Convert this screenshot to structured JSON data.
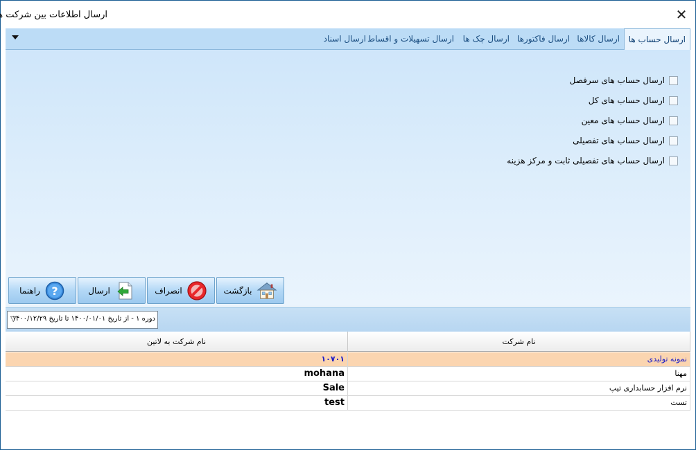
{
  "window": {
    "title": "ارسال اطلاعات بین شرکت ها",
    "close_glyph": "✕"
  },
  "tabs": [
    {
      "label": "ارسال حساب ها",
      "active": true
    },
    {
      "label": "ارسال کالاها",
      "active": false
    },
    {
      "label": "ارسال فاکتورها",
      "active": false
    },
    {
      "label": "ارسال چک ها",
      "active": false
    },
    {
      "label": "ارسال تسهیلات و اقساط",
      "active": false
    },
    {
      "label": "ارسال اسناد",
      "active": false
    }
  ],
  "checkboxes": [
    {
      "label": "ارسال حساب های سرفصل",
      "checked": false
    },
    {
      "label": "ارسال حساب های کل",
      "checked": false
    },
    {
      "label": "ارسال حساب های معین",
      "checked": false
    },
    {
      "label": "ارسال حساب های تفصیلی",
      "checked": false
    },
    {
      "label": "ارسال حساب های تفصیلی ثابت و مرکز هزینه",
      "checked": false
    }
  ],
  "buttons": {
    "back": {
      "label": "بازگشت",
      "icon": "house-icon"
    },
    "cancel": {
      "label": "انصراف",
      "icon": "no-entry-icon"
    },
    "send": {
      "label": "ارسال",
      "icon": "send-arrow-icon"
    },
    "help": {
      "label": "راهنما",
      "icon": "help-icon"
    }
  },
  "period_select": {
    "value": "دوره ۱ - از تاریخ ۱۴۰۰/۰۱/۰۱ تا تاریخ ۱۴۰۰/۱۲/۲۹"
  },
  "grid": {
    "columns": [
      "نام شرکت",
      "نام شرکت به لاتین"
    ],
    "rows": [
      {
        "name": "نمونه تولیدی",
        "latin": "۱۰۷۰۱",
        "selected": true
      },
      {
        "name": "مهنا",
        "latin": "mohana",
        "selected": false
      },
      {
        "name": "نرم افزار حسابداری تیپ",
        "latin": "Sale",
        "selected": false
      },
      {
        "name": "تست",
        "latin": "test",
        "selected": false
      }
    ]
  },
  "colors": {
    "titlebar_bg": "#ffffff",
    "tabstrip_bg": "#bcdcf6",
    "selected_row": "#fbd5b0",
    "selected_text": "#1a1ac8"
  }
}
